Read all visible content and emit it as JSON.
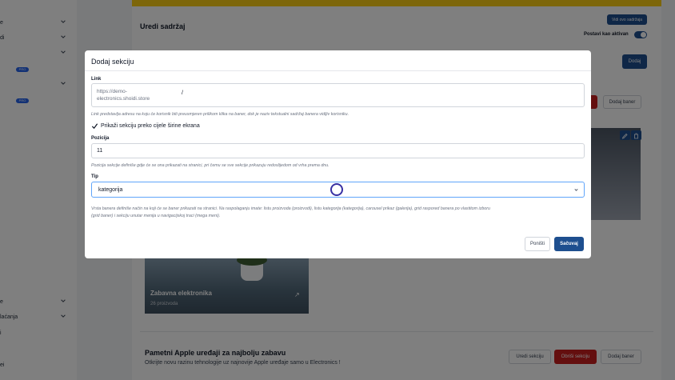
{
  "sidebar": {
    "items": [
      {
        "label": "e"
      },
      {
        "label": "di"
      },
      {
        "label": ""
      },
      {
        "label": ""
      },
      {
        "label": "e"
      },
      {
        "label": "laćanja"
      },
      {
        "label": "i"
      },
      {
        "label": "ei"
      }
    ],
    "badges": [
      "PRO",
      "PRO"
    ]
  },
  "page": {
    "title": "Uredi sadržaj",
    "view_button": "Vidi ovo sadržaja",
    "toggle_label": "Postavi kao aktivan",
    "add_button": "Dodaj",
    "add_banner_button": "Dodaj baner"
  },
  "tile": {
    "title": "Zabavna elektronika",
    "count": "26 proizvoda"
  },
  "section2": {
    "title": "Pametni Apple uređaji za najbolju zabavu",
    "subtitle": "Otkrijte novu razinu tehnologije uz najnovije Apple uređaje samo u Electronics !",
    "edit_button": "Uredi sekciju",
    "delete_button": "Obriši sekciju",
    "add_banner_button": "Dodaj baner"
  },
  "modal": {
    "title": "Dodaj sekciju",
    "link_label": "Link",
    "link_prefix": "https://demo-electronics.shoidi.store",
    "link_value": "/",
    "link_help": "Link predstavlja adresu na koju će korisnik biti preusmjeren prilikom klika na baner, dok je naziv tekstualni sadržaj banera vidljiv korisniku.",
    "fullwidth_label": "Prikaži sekciju preko cijele širine ekrana",
    "fullwidth_checked": true,
    "position_label": "Pozicija",
    "position_value": "11",
    "position_help": "Pozicija sekcije definiše gdje će se ona prikazati na stranici, pri čemu se sve sekcije prikazuju redoslijedom od vrha prema dnu.",
    "type_label": "Tip",
    "type_value": "kategorija",
    "type_help_line1": "Vrsta banera definiše način na koji će se baner prikazati na stranici. Na raspolaganju imate: listu proizvoda (proizvodi), listu kategorija (kategorija), carousel prikaz (galerija), grid raspored banera po vlastitom izboru",
    "type_help_line2": "(grid baner) i sekciju unutar menija u navigacijskoj traci (mega meni).",
    "cancel_button": "Poništi",
    "save_button": "Sačuvaj"
  },
  "colors": {
    "primary": "#1e4f8f",
    "danger": "#c81e1e",
    "accent_bar": "#facc15"
  }
}
